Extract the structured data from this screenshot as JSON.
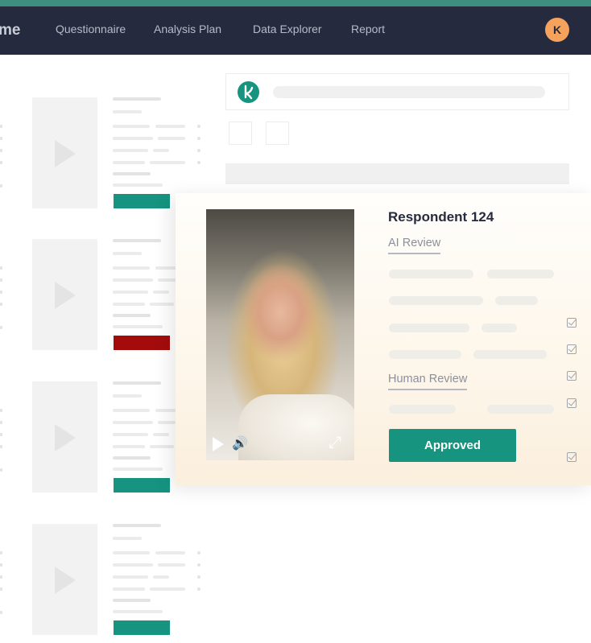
{
  "nav": {
    "brand": "me",
    "links": [
      "Questionnaire",
      "Analysis Plan",
      "Data Explorer",
      "Report"
    ],
    "avatar_initial": "K"
  },
  "review_card": {
    "title": "Respondent 124",
    "ai_review_label": "AI Review",
    "human_review_label": "Human Review",
    "approve_label": "Approved"
  },
  "rows": [
    {
      "status_color": "#16947f"
    },
    {
      "status_color": "#a40c0c"
    },
    {
      "status_color": "#16947f"
    },
    {
      "status_color": "#16947f"
    }
  ],
  "colors": {
    "accent_green": "#16947f",
    "nav_bg": "#262a3e",
    "top_stripe": "#3f8d7e",
    "reject_red": "#a40c0c",
    "avatar_orange": "#f5a25d"
  },
  "icons": {
    "logo": "leaf-logo-icon",
    "play": "play-icon",
    "volume": "volume-icon",
    "fullscreen": "fullscreen-icon",
    "checkbox": "checkbox-checked-icon"
  }
}
